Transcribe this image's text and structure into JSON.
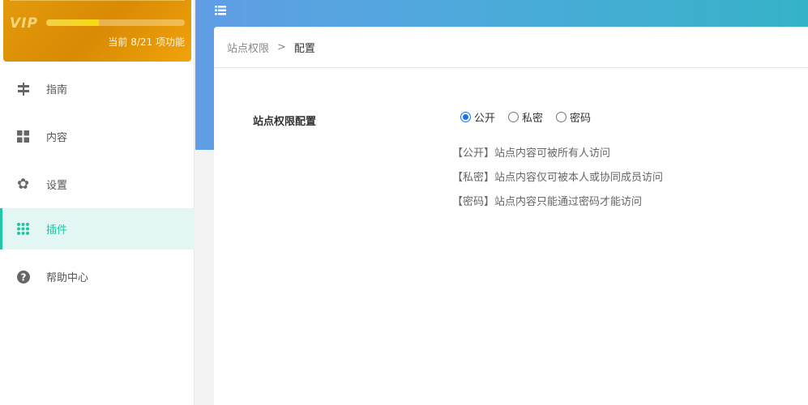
{
  "vip": {
    "logo": "VIP",
    "progress": 0.38,
    "status": "当前 8/21 项功能"
  },
  "sidebar": {
    "items": [
      {
        "label": "指南",
        "icon": "signpost-icon"
      },
      {
        "label": "内容",
        "icon": "grid-icon"
      },
      {
        "label": "设置",
        "icon": "gear-icon"
      },
      {
        "label": "插件",
        "icon": "apps-icon",
        "active": true
      },
      {
        "label": "帮助中心",
        "icon": "help-icon"
      }
    ]
  },
  "breadcrumb": {
    "parent": "站点权限",
    "separator": ">",
    "current": "配置"
  },
  "form": {
    "label": "站点权限配置",
    "options": [
      "公开",
      "私密",
      "密码"
    ],
    "selected": "公开",
    "descriptions": [
      "【公开】站点内容可被所有人访问",
      "【私密】站点内容仅可被本人或协同成员访问",
      "【密码】站点内容只能通过密码才能访问"
    ]
  },
  "colors": {
    "accent": "#1ec7a5",
    "radio": "#1a73e8"
  }
}
